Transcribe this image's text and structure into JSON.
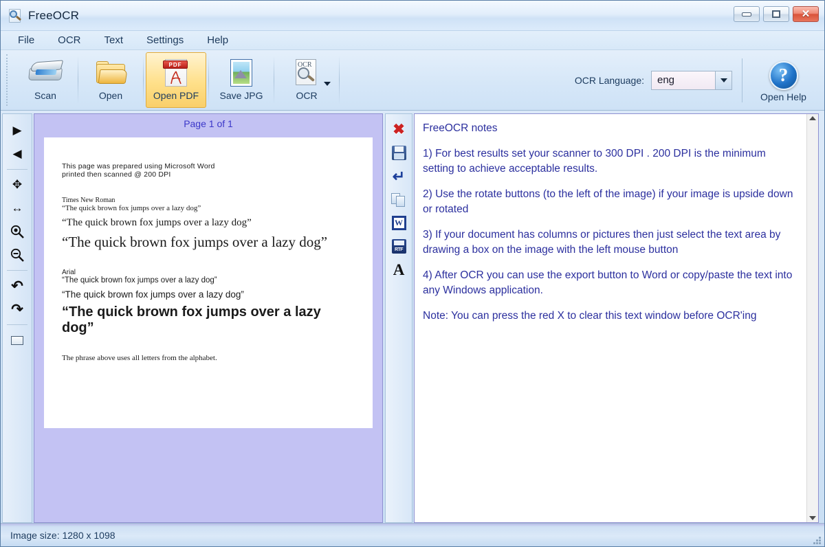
{
  "window": {
    "title": "FreeOCR",
    "icon": "magnifier-document-icon",
    "controls": {
      "minimize": "minimize",
      "maximize": "restore",
      "close": "✕"
    }
  },
  "menubar": {
    "items": [
      {
        "label": "File"
      },
      {
        "label": "OCR"
      },
      {
        "label": "Text"
      },
      {
        "label": "Settings"
      },
      {
        "label": "Help"
      }
    ]
  },
  "toolbar": {
    "buttons": [
      {
        "label": "Scan",
        "icon": "scanner-icon",
        "active": false
      },
      {
        "label": "Open",
        "icon": "folder-icon",
        "active": false
      },
      {
        "label": "Open PDF",
        "icon": "pdf-icon",
        "active": true
      },
      {
        "label": "Save JPG",
        "icon": "picture-icon",
        "active": false
      },
      {
        "label": "OCR",
        "icon": "ocr-document-icon",
        "active": false
      }
    ],
    "pdf_badge": "PDF",
    "ocr_doc_text": "OCR",
    "language": {
      "label": "OCR Language:",
      "value": "eng"
    },
    "help": {
      "glyph": "?",
      "label": "Open Help"
    }
  },
  "image_tools": {
    "buttons": [
      {
        "name": "next-page",
        "glyph": "▶"
      },
      {
        "name": "previous-page",
        "glyph": "◀"
      },
      {
        "name": "pan",
        "glyph": "✥"
      },
      {
        "name": "fit-width",
        "glyph": "↔"
      },
      {
        "name": "zoom-in",
        "glyph": "⌕"
      },
      {
        "name": "zoom-out",
        "glyph": "⌕"
      },
      {
        "name": "rotate-left",
        "glyph": "↶"
      },
      {
        "name": "rotate-right",
        "glyph": "↷"
      },
      {
        "name": "select-region",
        "glyph": ""
      }
    ]
  },
  "image_panel": {
    "page_label": "Page 1 of 1",
    "document": {
      "intro_line1": "This page was prepared using Microsoft Word",
      "intro_line2": "printed then scanned @ 200 DPI",
      "section1_title": "Times New Roman",
      "section1_line1": "“The quick brown fox jumps over a lazy dog”",
      "section1_line2": "“The quick brown fox jumps over a lazy dog”",
      "section1_line3": "“The quick brown fox jumps over a lazy dog”",
      "section2_title": "Arial",
      "section2_line1": "“The quick brown fox jumps over a lazy dog”",
      "section2_line2": "“The quick brown fox  jumps over a lazy dog”",
      "section2_line3": "“The quick brown fox jumps over a lazy dog”",
      "footer": "The phrase above uses all letters from the alphabet."
    }
  },
  "text_tools": {
    "buttons": [
      {
        "name": "clear-text",
        "glyph": "✖"
      },
      {
        "name": "save-text",
        "glyph": "save"
      },
      {
        "name": "word-wrap",
        "glyph": "↵"
      },
      {
        "name": "copy-text",
        "glyph": "copy"
      },
      {
        "name": "export-word",
        "glyph": "W"
      },
      {
        "name": "export-rtf",
        "glyph": "RTF"
      },
      {
        "name": "font",
        "glyph": "A"
      }
    ]
  },
  "text_panel": {
    "heading": "FreeOCR notes",
    "paragraphs": [
      "1) For best results set your scanner to 300 DPI . 200 DPI is the minimum setting to achieve acceptable results.",
      "2) Use the rotate buttons (to the left of the image) if your image is upside down or rotated",
      "3) If your document has columns or pictures then just select the text area by drawing a box on the image with the left mouse button",
      "4) After OCR you can use the export button to Word or copy/paste the text into any Windows application.",
      "Note: You can press the red X to clear this text window before OCR'ing"
    ]
  },
  "statusbar": {
    "text": "Image size:  1280 x 1098"
  },
  "colors": {
    "accent_blue": "#1f72c8",
    "text_blue": "#2b2f9e",
    "image_bg": "#c3c2f3",
    "highlight_orange": "#ffe08a",
    "close_red": "#d9533a"
  }
}
